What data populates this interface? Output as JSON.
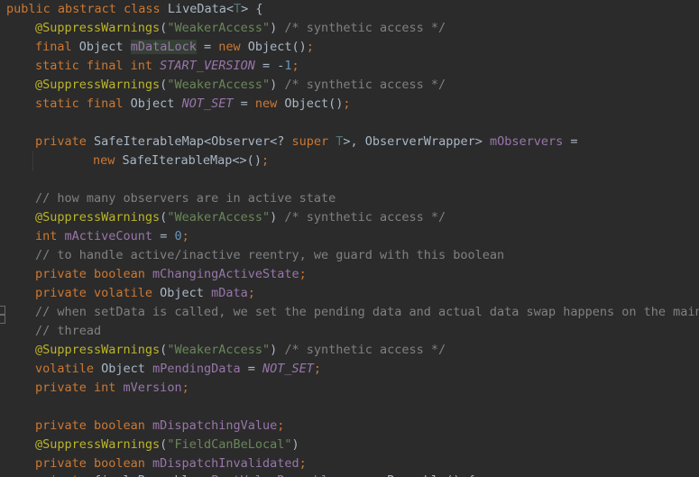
{
  "lines": [
    {
      "i": "0",
      "t": [
        [
          "kw",
          "public abstract class "
        ],
        [
          "pl",
          "LiveData<"
        ],
        [
          "tp",
          "T"
        ],
        [
          "pl",
          "> {"
        ]
      ]
    },
    {
      "i": "1",
      "t": [
        [
          "ann",
          "@SuppressWarnings"
        ],
        [
          "pl",
          "("
        ],
        [
          "str",
          "\"WeakerAccess\""
        ],
        [
          "pl",
          ") "
        ],
        [
          "cmt",
          "/* synthetic access */"
        ]
      ]
    },
    {
      "i": "1",
      "t": [
        [
          "kw",
          "final "
        ],
        [
          "pl",
          "Object "
        ],
        [
          "fld hl",
          "mDataLock"
        ],
        [
          "pl",
          " = "
        ],
        [
          "kw",
          "new "
        ],
        [
          "pl",
          "Object()"
        ],
        [
          "kw",
          ";"
        ]
      ]
    },
    {
      "i": "1",
      "t": [
        [
          "kw",
          "static final int "
        ],
        [
          "sfi",
          "START_VERSION"
        ],
        [
          "pl",
          " = -"
        ],
        [
          "num",
          "1"
        ],
        [
          "kw",
          ";"
        ]
      ]
    },
    {
      "i": "1",
      "t": [
        [
          "ann",
          "@SuppressWarnings"
        ],
        [
          "pl",
          "("
        ],
        [
          "str",
          "\"WeakerAccess\""
        ],
        [
          "pl",
          ") "
        ],
        [
          "cmt",
          "/* synthetic access */"
        ]
      ]
    },
    {
      "i": "1",
      "t": [
        [
          "kw",
          "static final "
        ],
        [
          "pl",
          "Object "
        ],
        [
          "sfi",
          "NOT_SET"
        ],
        [
          "pl",
          " = "
        ],
        [
          "kw",
          "new "
        ],
        [
          "pl",
          "Object()"
        ],
        [
          "kw",
          ";"
        ]
      ]
    },
    {
      "i": "1",
      "t": []
    },
    {
      "i": "1",
      "t": [
        [
          "kw",
          "private "
        ],
        [
          "pl",
          "SafeIterableMap<Observer<? "
        ],
        [
          "kw",
          "super "
        ],
        [
          "tp",
          "T"
        ],
        [
          "pl",
          ">, ObserverWrapper> "
        ],
        [
          "fld",
          "mObservers"
        ],
        [
          "pl",
          " ="
        ]
      ]
    },
    {
      "i": "2",
      "t": [
        [
          "kw",
          "new "
        ],
        [
          "pl",
          "SafeIterableMap<>()"
        ],
        [
          "kw",
          ";"
        ]
      ]
    },
    {
      "i": "1",
      "t": []
    },
    {
      "i": "1",
      "t": [
        [
          "cmt",
          "// how many observers are in active state"
        ]
      ]
    },
    {
      "i": "1",
      "t": [
        [
          "ann",
          "@SuppressWarnings"
        ],
        [
          "pl",
          "("
        ],
        [
          "str",
          "\"WeakerAccess\""
        ],
        [
          "pl",
          ") "
        ],
        [
          "cmt",
          "/* synthetic access */"
        ]
      ]
    },
    {
      "i": "1",
      "t": [
        [
          "kw",
          "int "
        ],
        [
          "fld",
          "mActiveCount"
        ],
        [
          "pl",
          " = "
        ],
        [
          "num",
          "0"
        ],
        [
          "kw",
          ";"
        ]
      ]
    },
    {
      "i": "1",
      "t": [
        [
          "cmt",
          "// to handle active/inactive reentry, we guard with this boolean"
        ]
      ]
    },
    {
      "i": "1",
      "t": [
        [
          "kw",
          "private boolean "
        ],
        [
          "fld",
          "mChangingActiveState"
        ],
        [
          "kw",
          ";"
        ]
      ]
    },
    {
      "i": "1",
      "t": [
        [
          "kw",
          "private volatile "
        ],
        [
          "pl",
          "Object "
        ],
        [
          "fld",
          "mData"
        ],
        [
          "kw",
          ";"
        ]
      ]
    },
    {
      "i": "1",
      "t": [
        [
          "cmt",
          "// when setData is called, we set the pending data and actual data swap happens on the main"
        ]
      ]
    },
    {
      "i": "1",
      "t": [
        [
          "cmt",
          "// thread"
        ]
      ]
    },
    {
      "i": "1",
      "t": [
        [
          "ann",
          "@SuppressWarnings"
        ],
        [
          "pl",
          "("
        ],
        [
          "str",
          "\"WeakerAccess\""
        ],
        [
          "pl",
          ") "
        ],
        [
          "cmt",
          "/* synthetic access */"
        ]
      ]
    },
    {
      "i": "1",
      "t": [
        [
          "kw",
          "volatile "
        ],
        [
          "pl",
          "Object "
        ],
        [
          "fld",
          "mPendingData"
        ],
        [
          "pl",
          " = "
        ],
        [
          "sfi",
          "NOT_SET"
        ],
        [
          "kw",
          ";"
        ]
      ]
    },
    {
      "i": "1",
      "t": [
        [
          "kw",
          "private int "
        ],
        [
          "fld",
          "mVersion"
        ],
        [
          "kw",
          ";"
        ]
      ]
    },
    {
      "i": "1",
      "t": []
    },
    {
      "i": "1",
      "t": [
        [
          "kw",
          "private boolean "
        ],
        [
          "fld",
          "mDispatchingValue"
        ],
        [
          "kw",
          ";"
        ]
      ]
    },
    {
      "i": "1",
      "t": [
        [
          "ann",
          "@SuppressWarnings"
        ],
        [
          "pl",
          "("
        ],
        [
          "str",
          "\"FieldCanBeLocal\""
        ],
        [
          "pl",
          ")"
        ]
      ]
    },
    {
      "i": "1",
      "t": [
        [
          "kw",
          "private boolean "
        ],
        [
          "fld",
          "mDispatchInvalidated"
        ],
        [
          "kw",
          ";"
        ]
      ]
    }
  ],
  "cutoff_line": [
    [
      "kw",
      "private "
    ],
    [
      "pl",
      "final "
    ],
    [
      "pl",
      "Runnable "
    ],
    [
      "fld",
      "mPostValueRunnable"
    ],
    [
      "pl",
      " = "
    ],
    [
      "kw",
      "new "
    ],
    [
      "pl",
      "Runnable() {"
    ]
  ]
}
